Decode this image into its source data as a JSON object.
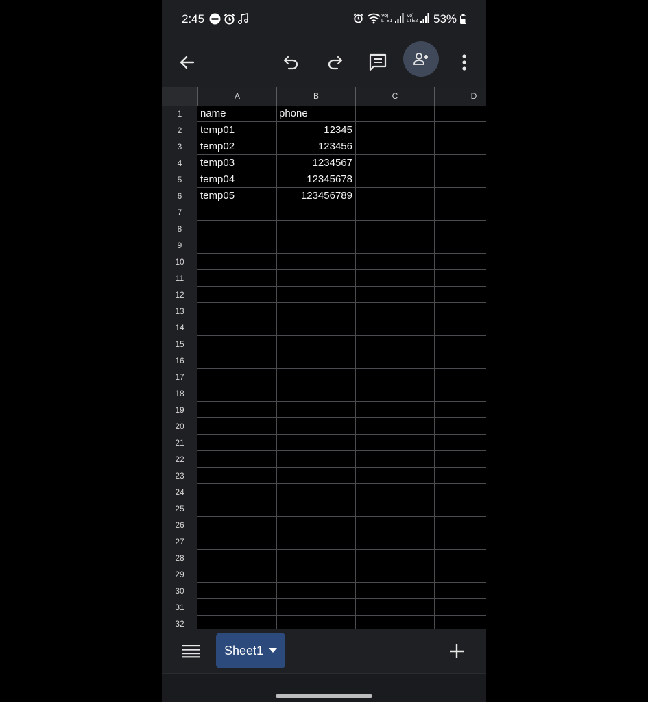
{
  "status_bar": {
    "time": "2:45",
    "battery_percent": "53%",
    "sim1_label": "Vo) LTE1",
    "sim2_label": "Vo) LTE2"
  },
  "toolbar": {
    "back_icon": "arrow-left-icon",
    "undo_icon": "undo-icon",
    "redo_icon": "redo-icon",
    "comment_icon": "comment-icon",
    "share_icon": "person-add-icon",
    "more_icon": "more-vert-icon"
  },
  "grid": {
    "columns": [
      "A",
      "B",
      "C",
      "D"
    ],
    "rows": [
      "1",
      "2",
      "3",
      "4",
      "5",
      "6",
      "7",
      "8",
      "9",
      "10",
      "11",
      "12",
      "13",
      "14",
      "15",
      "16",
      "17",
      "18",
      "19",
      "20",
      "21",
      "22",
      "23",
      "24",
      "25",
      "26",
      "27",
      "28",
      "29",
      "30",
      "31",
      "32"
    ],
    "cells": {
      "A1": "name",
      "B1": "phone",
      "A2": "temp01",
      "B2": "12345",
      "A3": "temp02",
      "B3": "123456",
      "A4": "temp03",
      "B4": "1234567",
      "A5": "temp04",
      "B5": "12345678",
      "A6": "temp05",
      "B6": "123456789"
    }
  },
  "bottom_bar": {
    "sheets_menu_icon": "menu-icon",
    "active_sheet": "Sheet1",
    "add_sheet_icon": "plus-icon"
  },
  "colors": {
    "background": "#000000",
    "toolbar": "#1e1f22",
    "sheet_tab": "#2c4a7c",
    "share_button": "#40495a"
  }
}
